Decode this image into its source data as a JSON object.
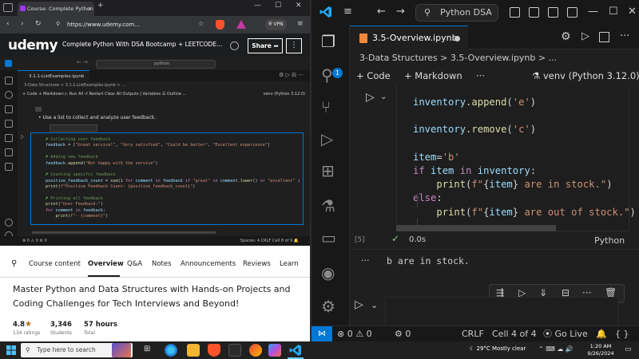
{
  "browser": {
    "tab_title": "Course: Complete Python W",
    "url": "https://www.udemy.com...",
    "vpn_label": "VPN",
    "logo_text": "udemy",
    "course_title": "Complete Python With DSA Bootcamp + LEETCODE...",
    "share_label": "Share",
    "more_label": "⋮"
  },
  "video": {
    "search_text": "python",
    "tab": "3.1.1-ListExamples.ipynb",
    "breadcrumb": "3-Data Structures  >  3.1.1-ListExamples.ipynb  >  ...",
    "toolbar": "+ Code   + Markdown   ▷ Run All   ↺ Restart   Clear All Outputs   |  Variables   ☰ Outline   ...",
    "kernel": "venv (Python 3.12.0)",
    "markdown": "•  Use a list to collect and analyze user feedback.",
    "status_left": "⊗ 0 ⚠ 0    ⚙ 0",
    "status_right": "Spaces: 4    CRLF    Cell 8 of 9    🔔"
  },
  "course_nav": {
    "items": [
      "Course content",
      "Overview",
      "Q&A",
      "Notes",
      "Announcements",
      "Reviews",
      "Learn"
    ],
    "active": "Overview"
  },
  "headline": "Master Python and Data Structures with Hands-on Projects and Coding Challenges for Tech Interviews and Beyond!",
  "stats": {
    "rating": "4.8",
    "rating_sub": "134 ratings",
    "students": "3,346",
    "students_sub": "Students",
    "hours": "57 hours",
    "hours_sub": "Total"
  },
  "vscode": {
    "command_center": "Python DSA",
    "tab_label": "3.5-Overview.ipynb",
    "badge": "1",
    "breadcrumb": "3-Data Structures  >  3.5-Overview.ipynb  >  ...",
    "toolbar_code": "+ Code",
    "toolbar_markdown": "+ Markdown",
    "toolbar_more": "···",
    "kernel": "venv (Python 3.12.0)",
    "execution_count": "[5]",
    "timing": "0.0s",
    "language": "Python",
    "output_prefix": "···",
    "output": "b are in stock.",
    "status": {
      "errors": "⊗ 0 ⚠ 0",
      "ports": "⚙ 0",
      "eol": "CRLF",
      "cell": "Cell 4 of 4",
      "golive": "Go Live",
      "bell": "🔔",
      "braces": "{ }"
    }
  },
  "taskbar": {
    "search_placeholder": "Type here to search",
    "weather": "29°C  Mostly clear",
    "time": "1:20 AM",
    "date": "9/26/2024"
  },
  "colors": {
    "vscode_blue": "#0078d4",
    "udemy_purple": "#a435f0",
    "rating_orange": "#b4690e"
  }
}
